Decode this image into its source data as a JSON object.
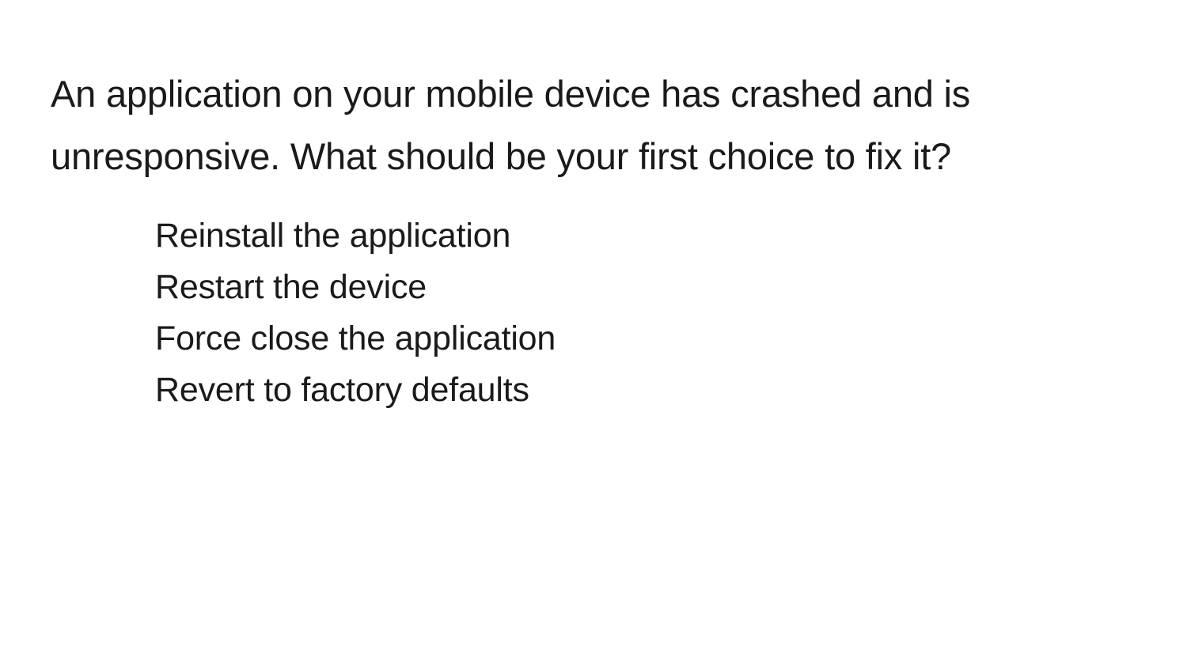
{
  "question": "An application on your mobile device has crashed and is unresponsive. What should be your first choice to fix it?",
  "options": [
    "Reinstall the application",
    "Restart the device",
    "Force close the application",
    "Revert to factory defaults"
  ]
}
